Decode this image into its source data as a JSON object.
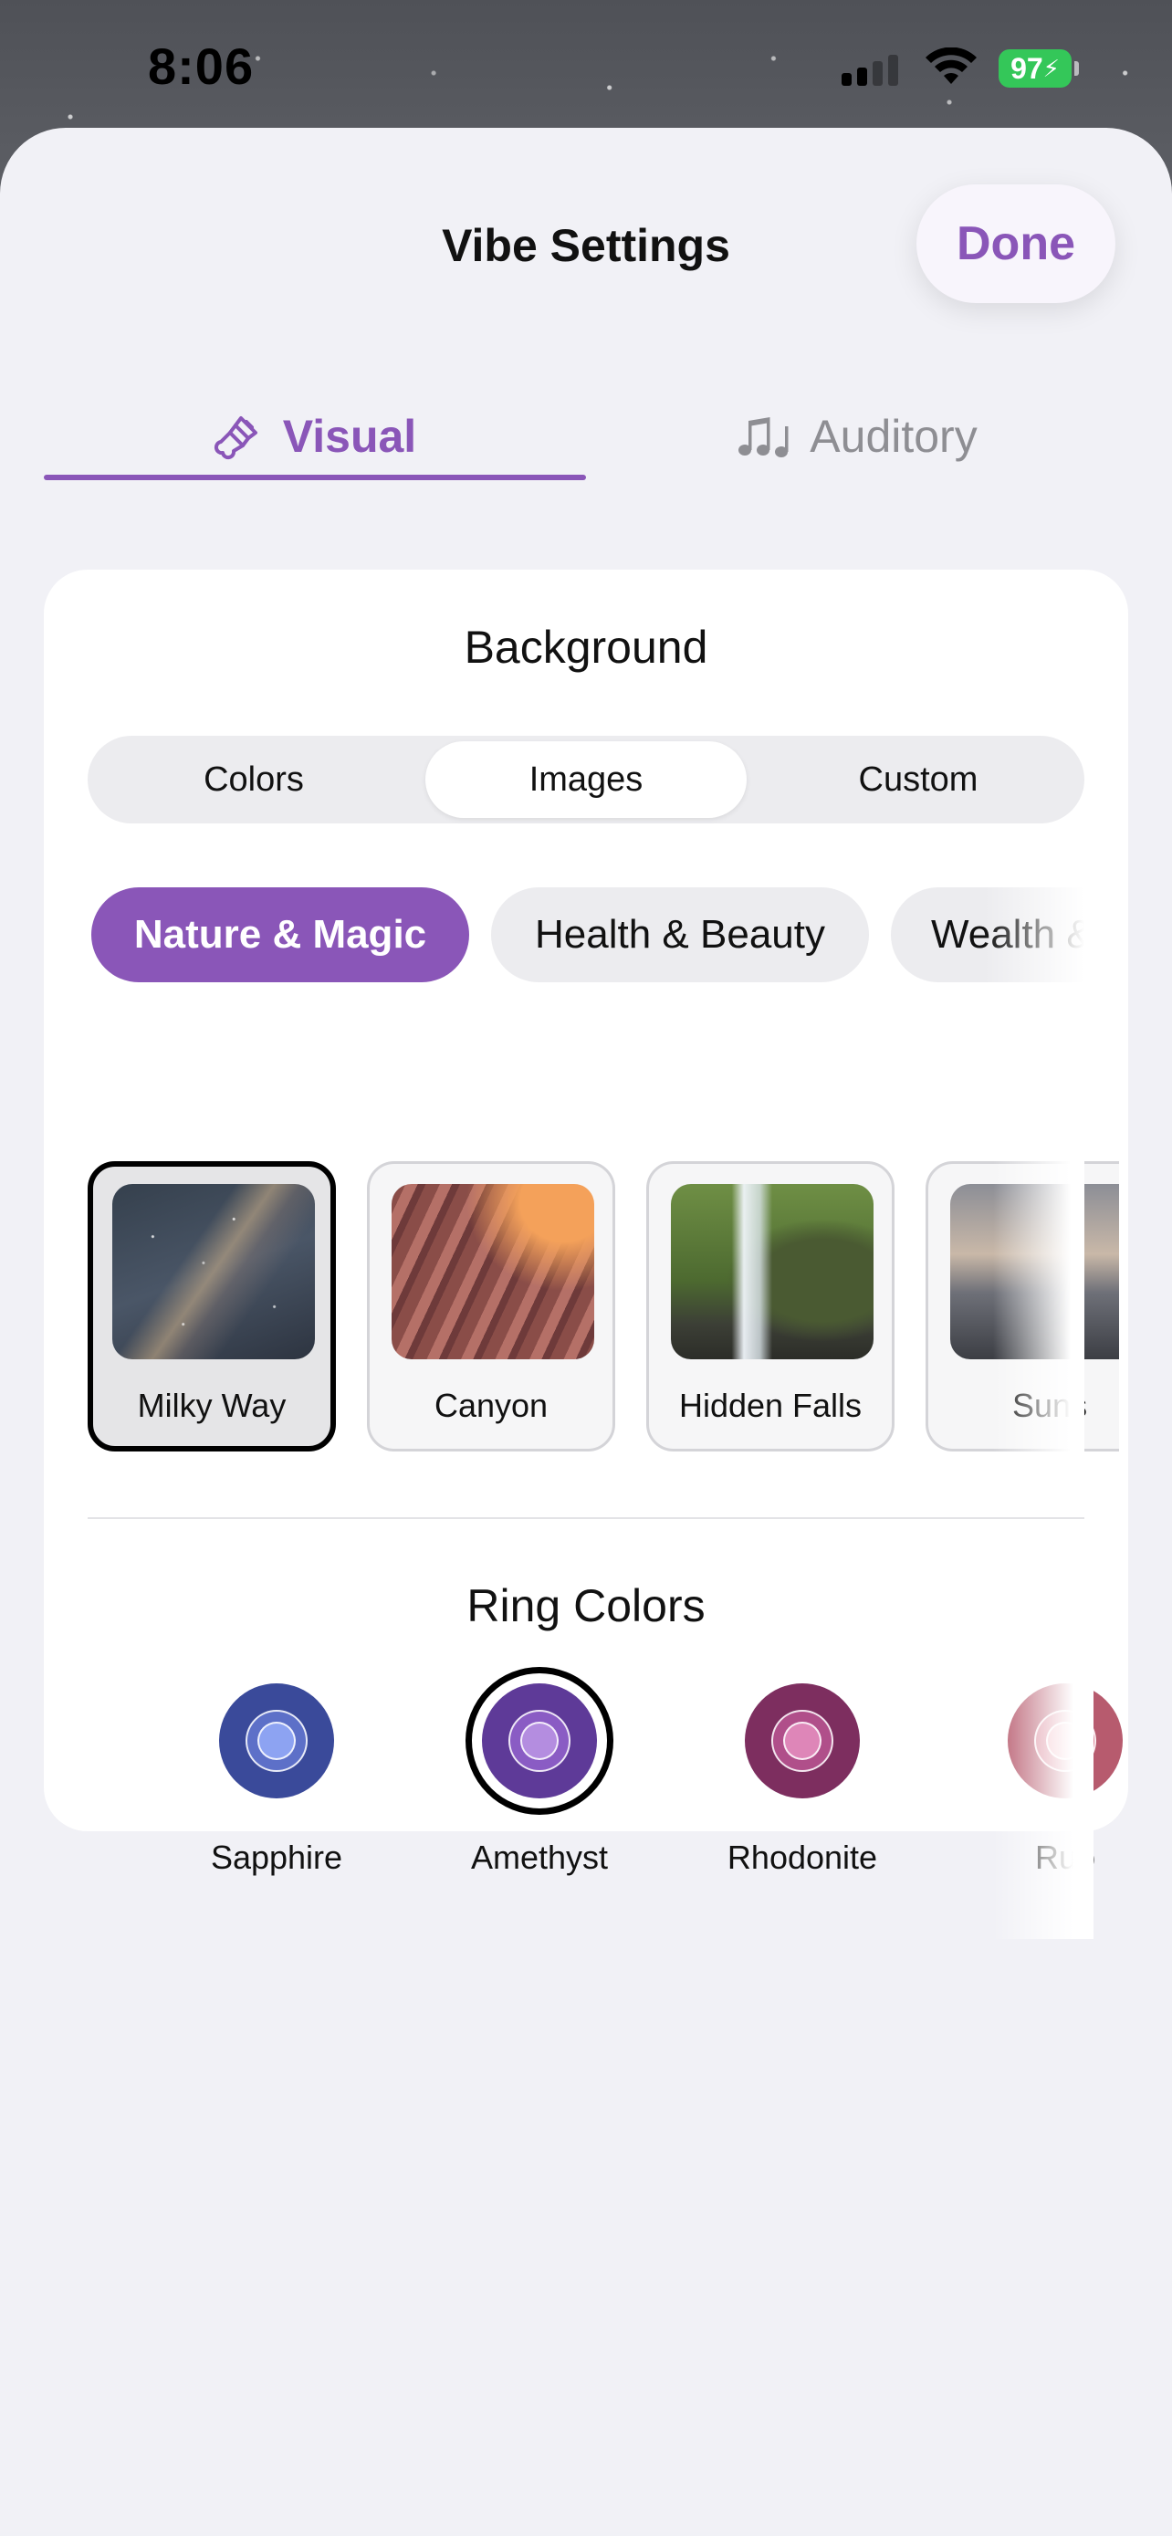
{
  "status_bar": {
    "time": "8:06",
    "battery": "97"
  },
  "sheet": {
    "title": "Vibe Settings",
    "done_label": "Done"
  },
  "main_tabs": [
    {
      "label": "Visual",
      "icon": "paintbrush-icon",
      "active": true
    },
    {
      "label": "Auditory",
      "icon": "music-notes-icon",
      "active": false
    }
  ],
  "background": {
    "title": "Background",
    "segments": [
      "Colors",
      "Images",
      "Custom"
    ],
    "selected_segment": "Images",
    "categories": [
      "Nature & Magic",
      "Health & Beauty",
      "Wealth &"
    ],
    "selected_category": "Nature & Magic",
    "images": [
      {
        "label": "Milky Way",
        "selected": true
      },
      {
        "label": "Canyon",
        "selected": false
      },
      {
        "label": "Hidden Falls",
        "selected": false
      },
      {
        "label": "Suns",
        "selected": false
      }
    ]
  },
  "ring_colors": {
    "title": "Ring Colors",
    "items": [
      {
        "label": "Sapphire",
        "color": "#3a4a9a",
        "inner": "#8da3f2",
        "selected": false
      },
      {
        "label": "Amethyst",
        "color": "#5e3a98",
        "inner": "#b48de0",
        "selected": true
      },
      {
        "label": "Rhodonite",
        "color": "#7d2e5f",
        "inner": "#de86b8",
        "selected": false
      },
      {
        "label": "Rub",
        "color": "#b75b6e",
        "inner": "#f0b2bd",
        "selected": false
      }
    ]
  },
  "colors": {
    "accent": "#8a56b8",
    "sheet_bg": "#f1f1f6"
  }
}
